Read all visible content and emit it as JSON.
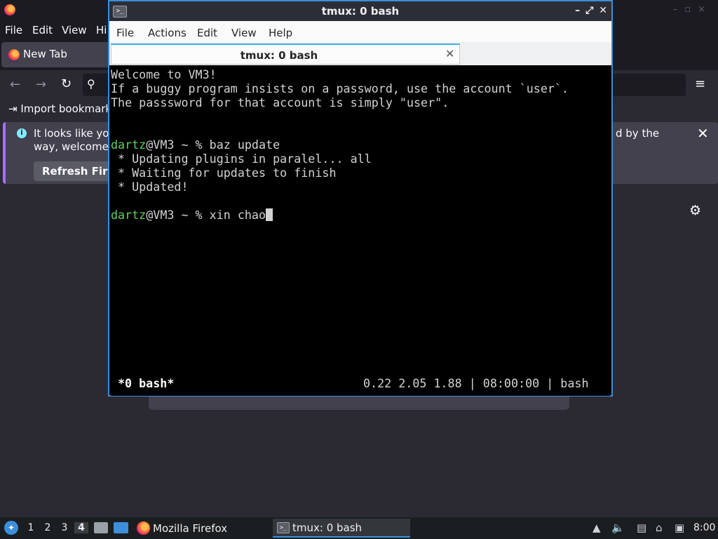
{
  "firefox": {
    "menu": [
      "File",
      "Edit",
      "View",
      "Hi"
    ],
    "tab_title": "New Tab",
    "bookmark_import": "Import bookmark",
    "notice_line1": "It looks like you",
    "notice_line2": "way, welcome",
    "notice_right": "d by the",
    "refresh_label": "Refresh Firef",
    "accent": "#a372f2"
  },
  "terminal": {
    "window_title": "tmux: 0 bash",
    "menu": [
      "File",
      "Actions",
      "Edit",
      "View",
      "Help"
    ],
    "tab_title": "tmux: 0 bash",
    "lines": [
      "Welcome to VM3!",
      "If a buggy program insists on a password, use the account `user`.",
      "The passsword for that account is simply \"user\".",
      "",
      "",
      "",
      " * Updating plugins in paralel... all",
      " * Waiting for updates to finish",
      " * Updated!",
      ""
    ],
    "prompt1_user": "dartz",
    "prompt1_rest": "@VM3 ~ % baz update",
    "prompt2_user": "dartz",
    "prompt2_rest": "@VM3 ~ % xin chao",
    "status_left": "*0 bash*",
    "status_right": "0.22 2.05 1.88 | 08:00:00 | bash",
    "prompt_color": "#5fd35f",
    "border_color": "#3b8edb"
  },
  "taskbar": {
    "workspaces": [
      "1",
      "2",
      "3",
      "4"
    ],
    "active_workspace": "4",
    "firefox_label": "Mozilla Firefox",
    "terminal_label": "tmux: 0 bash",
    "clock": "8:00"
  }
}
